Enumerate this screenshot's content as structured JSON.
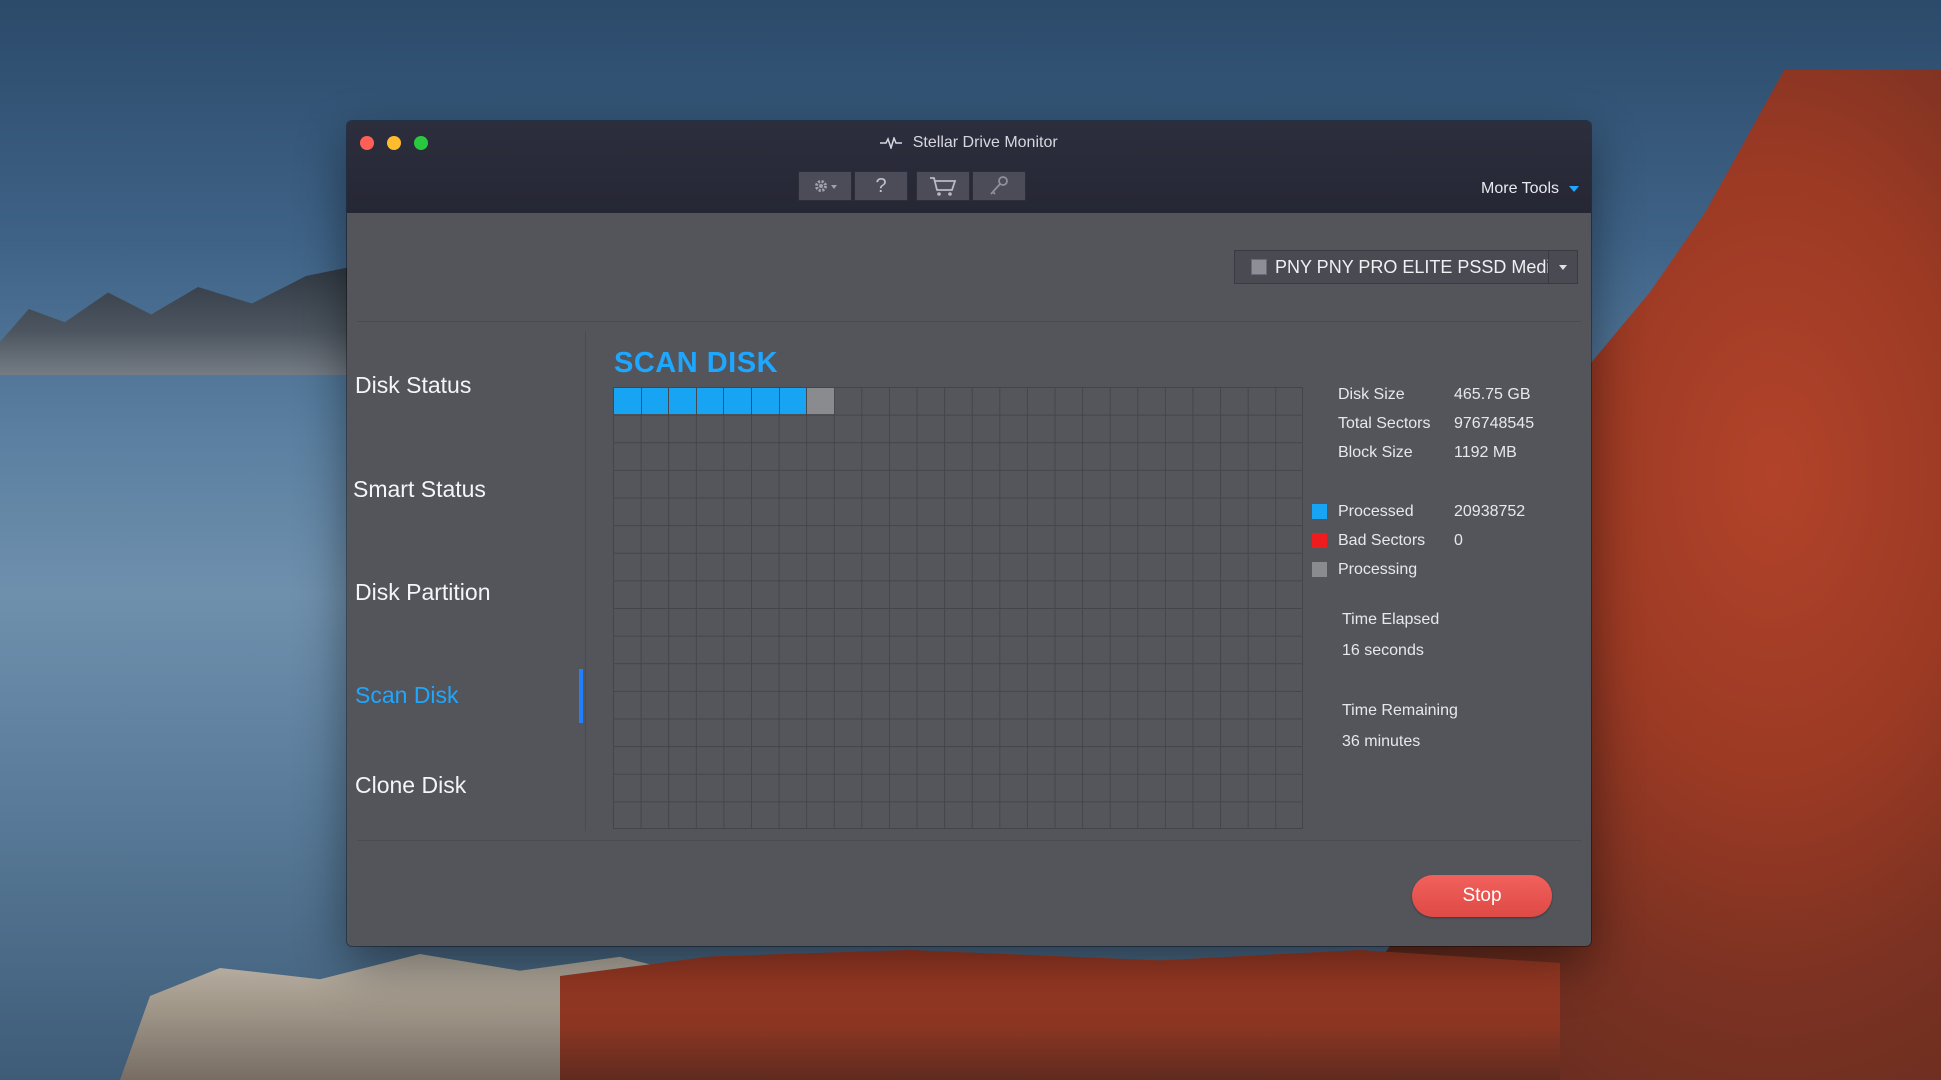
{
  "window": {
    "title": "Stellar Drive Monitor"
  },
  "toolbar": {
    "settings_icon": "gear-icon",
    "help_label": "?",
    "cart_icon": "cart-icon",
    "key_icon": "key-icon",
    "more_tools_label": "More Tools"
  },
  "drive_selector": {
    "selected": "PNY PNY PRO ELITE PSSD Medi"
  },
  "sidebar": {
    "items": [
      {
        "label": "Disk Status",
        "active": false
      },
      {
        "label": "Smart Status",
        "active": false
      },
      {
        "label": "Disk Partition",
        "active": false
      },
      {
        "label": "Scan Disk",
        "active": true
      },
      {
        "label": "Clone Disk",
        "active": false
      }
    ]
  },
  "scan": {
    "title": "SCAN DISK",
    "grid": {
      "columns": 25,
      "rows": 16,
      "processed_blocks": 7,
      "processing_blocks": 1
    },
    "info": {
      "disk_size_label": "Disk Size",
      "disk_size": "465.75 GB",
      "total_sectors_label": "Total Sectors",
      "total_sectors": "976748545",
      "block_size_label": "Block Size",
      "block_size": "1192 MB"
    },
    "legend": {
      "processed_label": "Processed",
      "processed_value": "20938752",
      "bad_sectors_label": "Bad Sectors",
      "bad_sectors_value": "0",
      "processing_label": "Processing"
    },
    "time": {
      "elapsed_label": "Time Elapsed",
      "elapsed_value": "16 seconds",
      "remaining_label": "Time Remaining",
      "remaining_value": "36 minutes"
    },
    "stop_label": "Stop"
  },
  "colors": {
    "accent": "#1ea7ff",
    "processed": "#17a4f3",
    "bad": "#ee1c1c",
    "processing": "#8a8b8f",
    "stop": "#e8514d"
  }
}
